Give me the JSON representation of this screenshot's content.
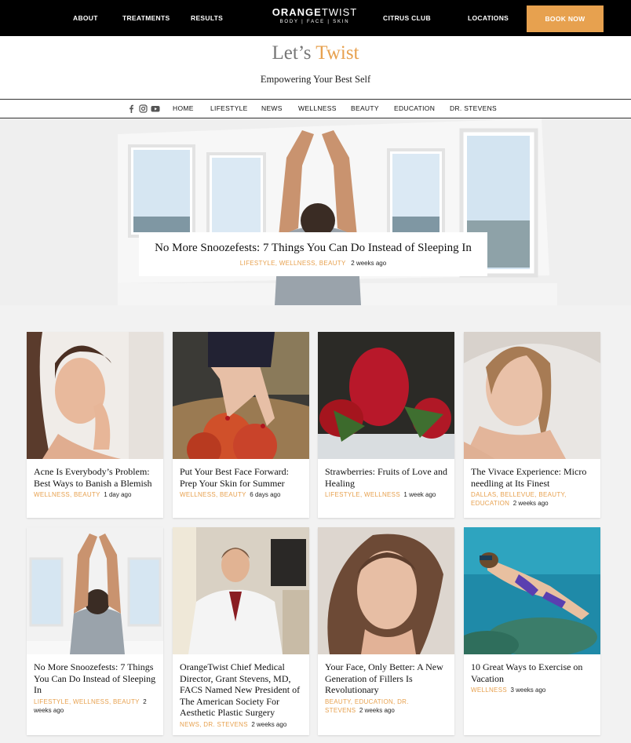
{
  "topnav": {
    "about": "ABOUT",
    "treatments": "TREATMENTS",
    "results": "RESULTS",
    "logo_main_bold": "ORANGE",
    "logo_main_light": "TWIST",
    "logo_sub": "BODY | FACE | SKIN",
    "citrus_club": "CITRUS CLUB",
    "locations": "LOCATIONS",
    "book_now": "BOOK NOW"
  },
  "blog": {
    "title_plain": "Let’s ",
    "title_accent": "Twist",
    "tagline": "Empowering Your Best Self"
  },
  "subnav": {
    "social_icons": [
      "facebook-icon",
      "instagram-icon",
      "youtube-icon"
    ],
    "items": [
      "HOME",
      "LIFESTYLE",
      "NEWS",
      "WELLNESS",
      "BEAUTY",
      "EDUCATION",
      "DR. STEVENS"
    ]
  },
  "hero": {
    "title": "No More Snoozefests: 7 Things You Can Do Instead of Sleeping In",
    "tags": "LIFESTYLE,  WELLNESS,  BEAUTY",
    "ago": "2 weeks ago"
  },
  "posts": [
    {
      "title": "Acne Is Everybody’s Problem: Best Ways to Banish a Blemish",
      "tags": "WELLNESS,  BEAUTY",
      "ago": "1 day ago"
    },
    {
      "title": "Put Your Best Face Forward: Prep Your Skin for Summer",
      "tags": "WELLNESS,  BEAUTY",
      "ago": "6 days ago"
    },
    {
      "title": "Strawberries: Fruits of Love and Healing",
      "tags": "LIFESTYLE,  WELLNESS",
      "ago": "1 week ago"
    },
    {
      "title": "The Vivace Experience: Micro needling at Its Finest",
      "tags": "DALLAS,  BELLEVUE,  BEAUTY,  EDUCATION",
      "ago": "2 weeks ago"
    },
    {
      "title": "No More Snoozefests: 7 Things You Can Do Instead of Sleeping In",
      "tags": "LIFESTYLE,  WELLNESS,  BEAUTY",
      "ago": "2 weeks ago"
    },
    {
      "title": "OrangeTwist Chief Medical Director, Grant Stevens, MD, FACS Named New President of The American Society For Aesthetic Plastic Surgery",
      "tags": "NEWS,  DR. STEVENS",
      "ago": "2 weeks ago"
    },
    {
      "title": "Your Face, Only Better: A New Generation of Fillers Is Revolutionary",
      "tags": "BEAUTY,  EDUCATION,  DR. STEVENS",
      "ago": "2 weeks ago"
    },
    {
      "title": "10 Great Ways to Exercise on Vacation",
      "tags": "WELLNESS",
      "ago": "3 weeks ago"
    }
  ],
  "colors": {
    "accent": "#e7a14f",
    "topbar": "#000000",
    "page_bg": "#f2f2f2"
  }
}
